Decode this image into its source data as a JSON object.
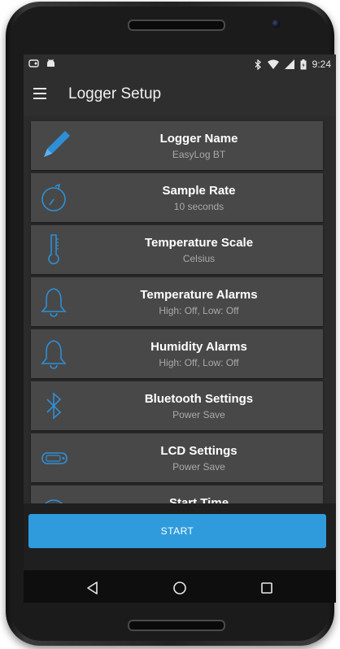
{
  "status_bar": {
    "time": "9:24",
    "left_icons": [
      "cast-icon",
      "android-icon"
    ],
    "right_icons": [
      "bluetooth-icon",
      "wifi-icon",
      "signal-icon",
      "battery-icon"
    ]
  },
  "app_bar": {
    "title": "Logger Setup",
    "menu_icon": "hamburger-icon"
  },
  "settings": [
    {
      "title": "Logger Name",
      "value": "EasyLog BT",
      "icon": "pencil-icon"
    },
    {
      "title": "Sample Rate",
      "value": "10 seconds",
      "icon": "timer-icon"
    },
    {
      "title": "Temperature Scale",
      "value": "Celsius",
      "icon": "thermometer-icon"
    },
    {
      "title": "Temperature Alarms",
      "value": "High: Off, Low: Off",
      "icon": "bell-icon"
    },
    {
      "title": "Humidity Alarms",
      "value": "High: Off, Low: Off",
      "icon": "bell-icon"
    },
    {
      "title": "Bluetooth Settings",
      "value": "Power Save",
      "icon": "bluetooth-icon"
    },
    {
      "title": "LCD Settings",
      "value": "Power Save",
      "icon": "lcd-icon"
    },
    {
      "title": "Start Time",
      "value": "",
      "icon": "clock-icon"
    }
  ],
  "start_button": {
    "label": "START"
  },
  "nav_bar": {
    "icons": [
      "back-icon",
      "home-icon",
      "recents-icon"
    ]
  },
  "colors": {
    "accent": "#2f9bdc",
    "icon_blue": "#2e8fd6",
    "row_bg": "#484848"
  }
}
